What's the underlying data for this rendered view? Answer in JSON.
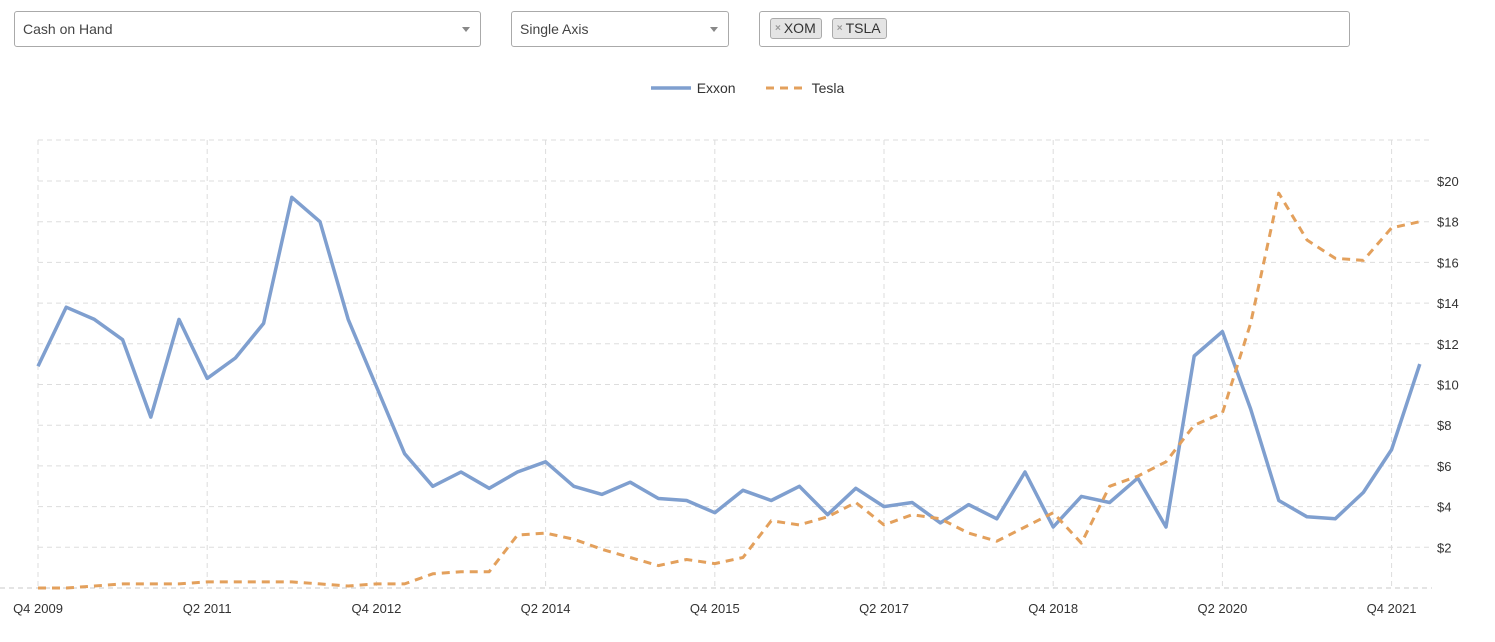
{
  "controls": {
    "metric_select": "Cash on Hand",
    "axis_select": "Single Axis",
    "tickers": [
      {
        "label": "XOM",
        "remove": "×"
      },
      {
        "label": "TSLA",
        "remove": "×"
      }
    ]
  },
  "colors": {
    "exxon": "#7f9fcf",
    "tesla": "#e3a05c",
    "grid": "#dddddd"
  },
  "chart_data": {
    "type": "line",
    "title": "",
    "xlabel": "",
    "ylabel": "",
    "x_ticks": [
      "Q4 2009",
      "Q2 2011",
      "Q4 2012",
      "Q2 2014",
      "Q4 2015",
      "Q2 2017",
      "Q4 2018",
      "Q2 2020",
      "Q4 2021"
    ],
    "y_ticks": [
      "$2",
      "$4",
      "$6",
      "$8",
      "$10",
      "$12",
      "$14",
      "$16",
      "$18",
      "$20"
    ],
    "ylim": [
      0,
      22
    ],
    "y_axis_side": "right",
    "grid": true,
    "legend": "top-center",
    "x": [
      "Q4 2009",
      "Q1 2010",
      "Q2 2010",
      "Q3 2010",
      "Q4 2010",
      "Q1 2011",
      "Q2 2011",
      "Q3 2011",
      "Q4 2011",
      "Q1 2012",
      "Q2 2012",
      "Q3 2012",
      "Q4 2012",
      "Q1 2013",
      "Q2 2013",
      "Q3 2013",
      "Q4 2013",
      "Q1 2014",
      "Q2 2014",
      "Q3 2014",
      "Q4 2014",
      "Q1 2015",
      "Q2 2015",
      "Q3 2015",
      "Q4 2015",
      "Q1 2016",
      "Q2 2016",
      "Q3 2016",
      "Q4 2016",
      "Q1 2017",
      "Q2 2017",
      "Q3 2017",
      "Q4 2017",
      "Q1 2018",
      "Q2 2018",
      "Q3 2018",
      "Q4 2018",
      "Q1 2019",
      "Q2 2019",
      "Q3 2019",
      "Q4 2019",
      "Q1 2020",
      "Q2 2020",
      "Q3 2020",
      "Q4 2020",
      "Q1 2021",
      "Q2 2021",
      "Q3 2021",
      "Q4 2021",
      "Q1 2022"
    ],
    "series": [
      {
        "name": "Exxon",
        "style": "solid",
        "values": [
          10.9,
          13.8,
          13.2,
          12.2,
          8.4,
          13.2,
          10.3,
          11.3,
          13.0,
          19.2,
          18.0,
          13.2,
          9.9,
          6.6,
          5.0,
          5.7,
          4.9,
          5.7,
          6.2,
          5.0,
          4.6,
          5.2,
          4.4,
          4.3,
          3.7,
          4.8,
          4.3,
          5.0,
          3.6,
          4.9,
          4.0,
          4.2,
          3.2,
          4.1,
          3.4,
          5.7,
          3.0,
          4.5,
          4.2,
          5.4,
          3.0,
          11.4,
          12.6,
          8.8,
          4.3,
          3.5,
          3.4,
          4.7,
          6.8,
          11.0
        ]
      },
      {
        "name": "Tesla",
        "style": "dashed",
        "values": [
          0.0,
          0.0,
          0.1,
          0.2,
          0.2,
          0.2,
          0.3,
          0.3,
          0.3,
          0.3,
          0.2,
          0.1,
          0.2,
          0.2,
          0.7,
          0.8,
          0.8,
          2.6,
          2.7,
          2.4,
          1.9,
          1.5,
          1.1,
          1.4,
          1.2,
          1.5,
          3.3,
          3.1,
          3.5,
          4.2,
          3.1,
          3.6,
          3.4,
          2.7,
          2.3,
          3.0,
          3.7,
          2.2,
          5.0,
          5.5,
          6.2,
          8.0,
          8.6,
          13.0,
          19.4,
          17.1,
          16.2,
          16.1,
          17.7,
          18.0
        ]
      }
    ]
  }
}
